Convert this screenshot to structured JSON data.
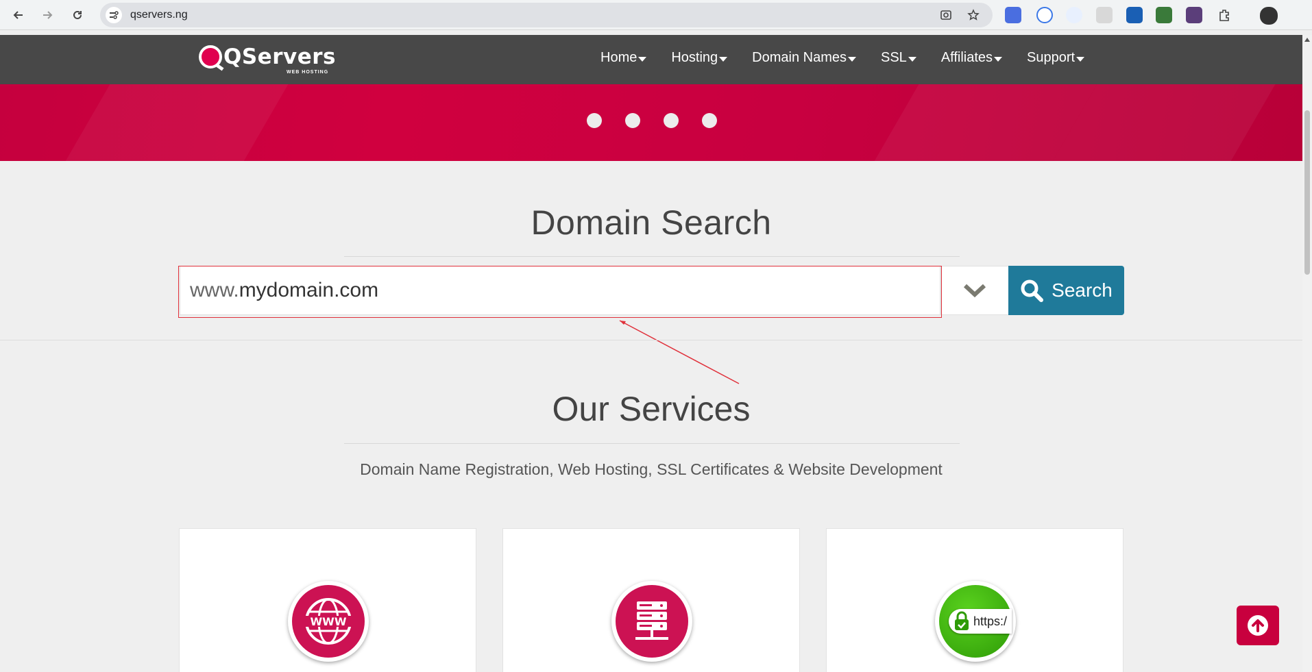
{
  "browser": {
    "url": "qservers.ng",
    "icons": [
      "back-icon",
      "forward-icon",
      "reload-icon",
      "site-info-icon",
      "screenshot-icon",
      "star-icon",
      "extensions-icon",
      "profile-avatar"
    ]
  },
  "header": {
    "logo_text": "QServers",
    "logo_tagline": "WEB HOSTING",
    "nav": [
      {
        "label": "Home"
      },
      {
        "label": "Hosting"
      },
      {
        "label": "Domain Names"
      },
      {
        "label": "SSL"
      },
      {
        "label": "Affiliates"
      },
      {
        "label": "Support"
      }
    ]
  },
  "hero": {
    "slides": 4
  },
  "domain_search": {
    "title": "Domain Search",
    "prefix": "www.",
    "placeholder": "mydomain.com",
    "button_label": "Search"
  },
  "services": {
    "title": "Our Services",
    "subtitle": "Domain Name Registration, Web Hosting, SSL Certificates & Website Development",
    "cards": [
      {
        "icon": "www-globe-icon"
      },
      {
        "icon": "server-icon"
      },
      {
        "icon": "https-lock-icon",
        "badge_text": "https:/"
      }
    ]
  },
  "colors": {
    "header_bg": "#484848",
    "brand_red": "#c8003e",
    "search_blue": "#1f7a9a",
    "annotation_red": "#e0303a"
  }
}
